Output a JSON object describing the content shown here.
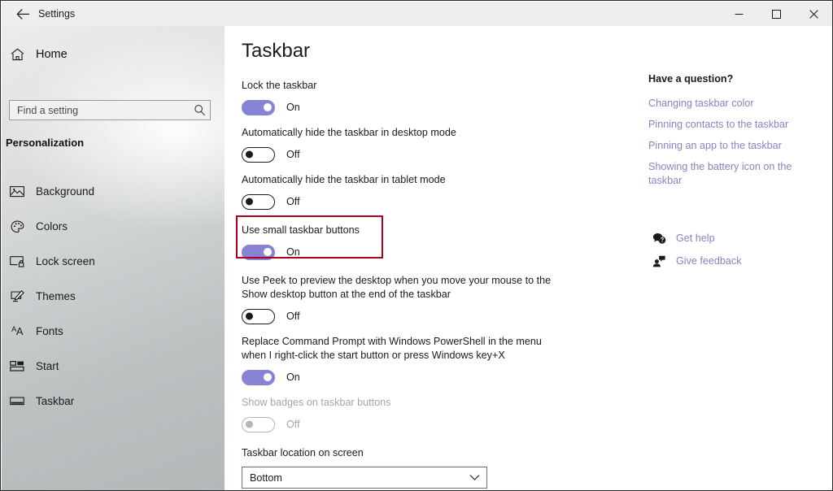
{
  "titlebar": {
    "app_title": "Settings",
    "back_icon": "back-arrow-icon",
    "minimize_label": "Minimize",
    "maximize_label": "Maximize",
    "close_label": "Close"
  },
  "sidebar": {
    "home_label": "Home",
    "home_icon": "home-icon",
    "search": {
      "placeholder": "Find a setting",
      "value": "",
      "icon": "search-icon"
    },
    "section_title": "Personalization",
    "items": [
      {
        "label": "Background",
        "icon": "image-icon"
      },
      {
        "label": "Colors",
        "icon": "palette-icon"
      },
      {
        "label": "Lock screen",
        "icon": "lock-screen-icon"
      },
      {
        "label": "Themes",
        "icon": "themes-brush-icon"
      },
      {
        "label": "Fonts",
        "icon": "fonts-aa-icon"
      },
      {
        "label": "Start",
        "icon": "start-tiles-icon"
      },
      {
        "label": "Taskbar",
        "icon": "taskbar-icon"
      }
    ]
  },
  "main": {
    "page_title": "Taskbar",
    "settings": [
      {
        "label": "Lock the taskbar",
        "state": "On",
        "on": true,
        "disabled": false
      },
      {
        "label": "Automatically hide the taskbar in desktop mode",
        "state": "Off",
        "on": false,
        "disabled": false
      },
      {
        "label": "Automatically hide the taskbar in tablet mode",
        "state": "Off",
        "on": false,
        "disabled": false
      },
      {
        "label": "Use small taskbar buttons",
        "state": "On",
        "on": true,
        "disabled": false,
        "highlighted": true
      },
      {
        "label": "Use Peek to preview the desktop when you move your mouse to the Show desktop button at the end of the taskbar",
        "state": "Off",
        "on": false,
        "disabled": false
      },
      {
        "label": "Replace Command Prompt with Windows PowerShell in the menu when I right-click the start button or press Windows key+X",
        "state": "On",
        "on": true,
        "disabled": false
      },
      {
        "label": "Show badges on taskbar buttons",
        "state": "Off",
        "on": false,
        "disabled": true
      }
    ],
    "dropdown": {
      "label": "Taskbar location on screen",
      "value": "Bottom",
      "chevron_icon": "chevron-down-icon"
    }
  },
  "help": {
    "heading": "Have a question?",
    "links": [
      "Changing taskbar color",
      "Pinning contacts to the taskbar",
      "Pinning an app to the taskbar",
      "Showing the battery icon on the taskbar"
    ],
    "support": [
      {
        "label": "Get help",
        "icon": "get-help-icon"
      },
      {
        "label": "Give feedback",
        "icon": "give-feedback-icon"
      }
    ]
  },
  "colors": {
    "accent_toggle": "#8884d5",
    "link": "#8882c4",
    "highlight_box": "#b00020",
    "text": "#1b1b1b",
    "disabled_text": "#a5a5a5"
  }
}
